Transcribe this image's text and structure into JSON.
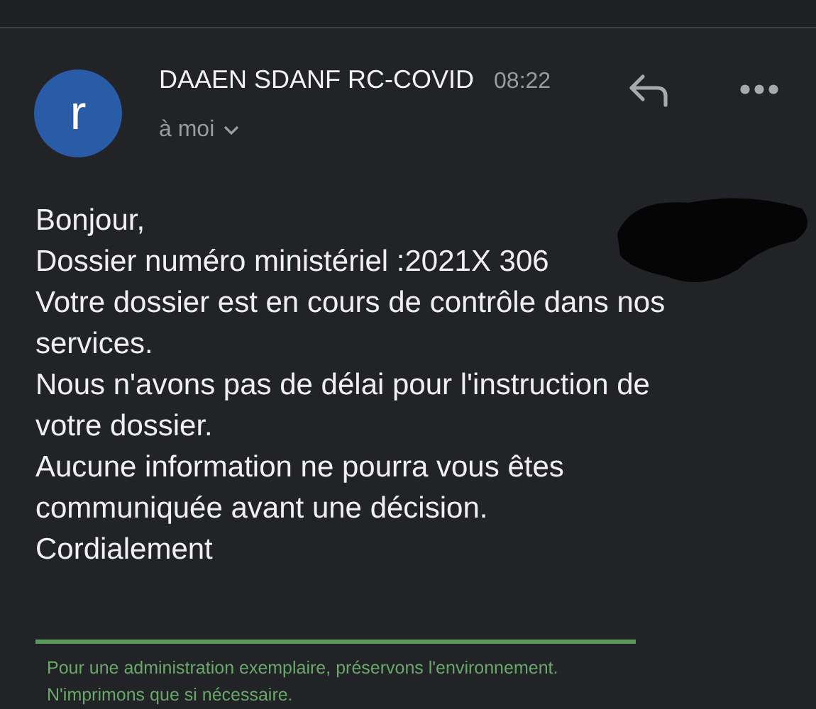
{
  "sender": {
    "avatar_letter": "r",
    "name": "DAAEN SDANF RC-COVID",
    "time": "08:22",
    "recipient": "à moi"
  },
  "body_lines": [
    "Bonjour,",
    "Dossier numéro ministériel :2021X 306",
    "Votre dossier est en cours de contrôle dans nos",
    "services.",
    "Nous n'avons pas de délai pour l'instruction de",
    "votre dossier.",
    "Aucune information ne pourra vous êtes",
    "communiquée avant une décision.",
    "Cordialement"
  ],
  "footer_lines": [
    "Pour une administration exemplaire, préservons l'environnement.",
    "N'imprimons que si nécessaire."
  ]
}
